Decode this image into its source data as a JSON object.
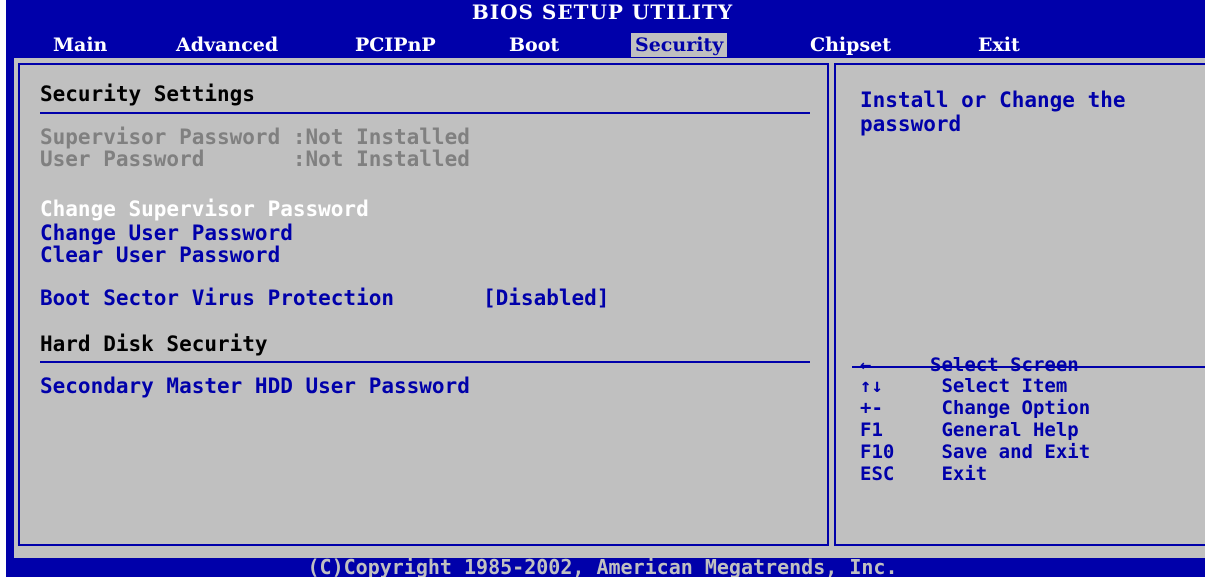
{
  "header": {
    "title": "BIOS SETUP UTILITY"
  },
  "menu": [
    {
      "label": "Main"
    },
    {
      "label": "Advanced"
    },
    {
      "label": "PCIPnP"
    },
    {
      "label": "Boot"
    },
    {
      "label": "Security"
    },
    {
      "label": "Chipset"
    },
    {
      "label": "Exit"
    }
  ],
  "security": {
    "section_title": "Security Settings",
    "supervisor_password": "Supervisor Password :Not Installed",
    "user_password": "User Password       :Not Installed",
    "change_supervisor": "Change Supervisor Password",
    "change_user": "Change User Password",
    "clear_user": "Clear User Password",
    "boot_sector_label": "Boot Sector Virus Protection",
    "boot_sector_value": "[Disabled]",
    "hdd_section_title": "Hard Disk Security",
    "hdd_user_password": "Secondary Master HDD User Password"
  },
  "help": {
    "line1": "Install or Change the",
    "line2": "password"
  },
  "legend": [
    {
      "key": "←",
      "desc": "Select Screen"
    },
    {
      "key": "↑↓",
      "desc": " Select Item"
    },
    {
      "key": "+-",
      "desc": " Change Option"
    },
    {
      "key": "F1",
      "desc": " General Help"
    },
    {
      "key": "F10",
      "desc": " Save and Exit"
    },
    {
      "key": "ESC",
      "desc": " Exit"
    }
  ],
  "footer": {
    "copyright": "(C)Copyright 1985-2002, American Megatrends, Inc."
  },
  "colors": {
    "background": "#0000aa",
    "panel": "#c0c0c0",
    "highlight_text": "#ffffff",
    "disabled_text": "#808080"
  }
}
